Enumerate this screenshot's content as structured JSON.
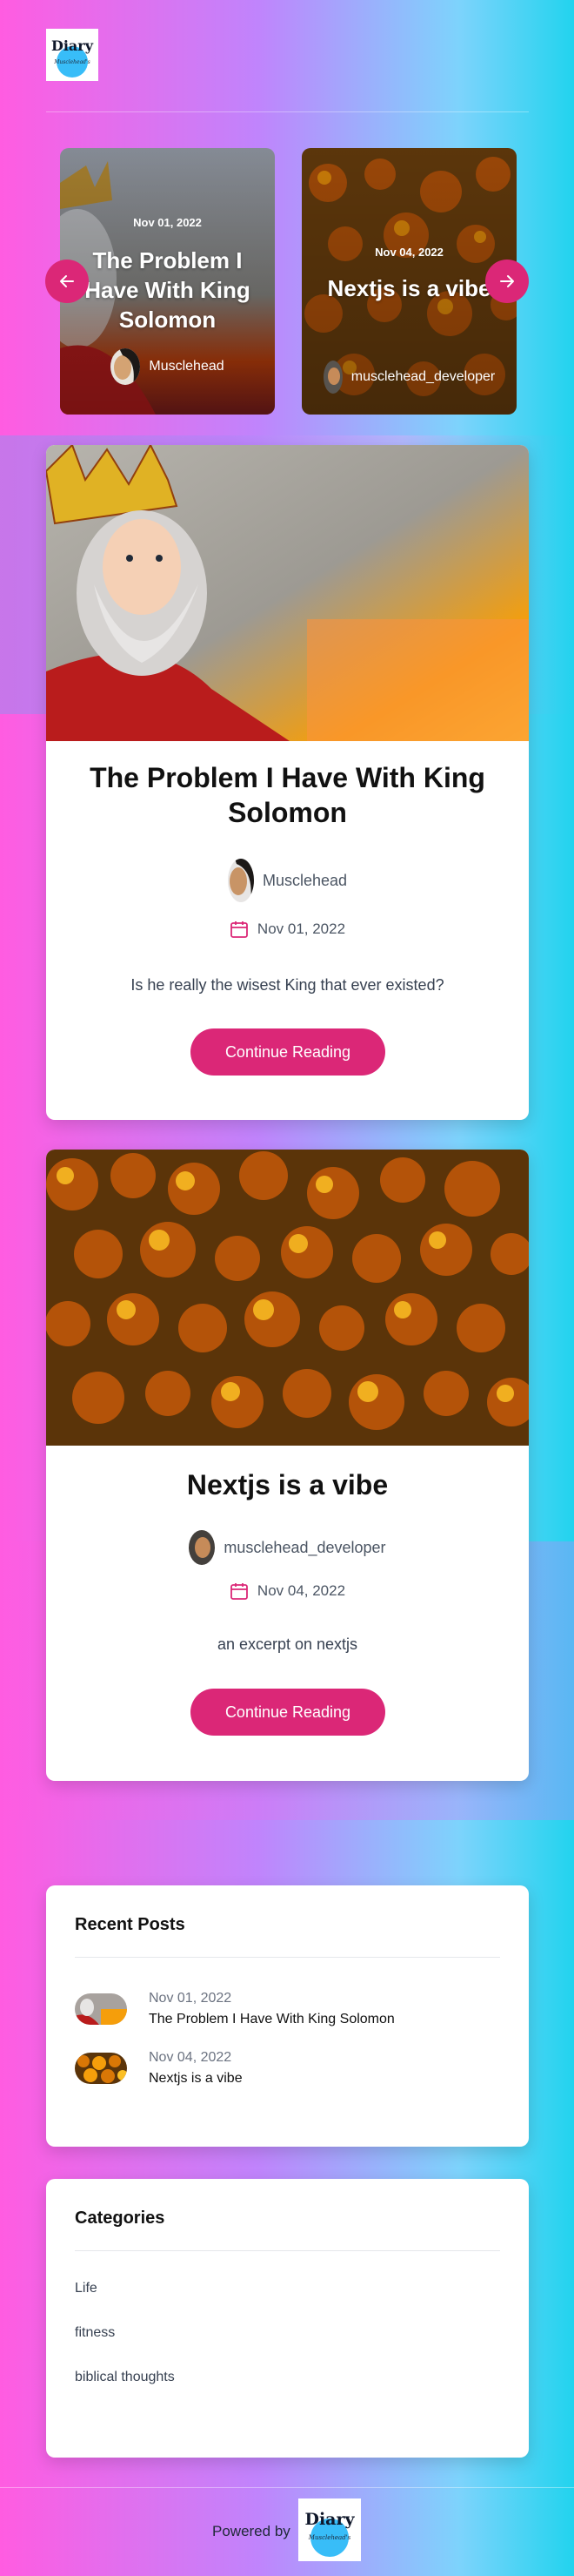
{
  "brand": {
    "logo_text": "Diary",
    "logo_subtext": "Musclehead's"
  },
  "carousel": {
    "prev_icon": "arrow-left-icon",
    "next_icon": "arrow-right-icon",
    "slides": [
      {
        "date": "Nov 01, 2022",
        "title": "The Problem I Have With King Solomon",
        "author": "Musclehead"
      },
      {
        "date": "Nov 04, 2022",
        "title": "Nextjs is a vibe",
        "author": "musclehead_developer"
      }
    ]
  },
  "posts": [
    {
      "title": "The Problem I Have With King Solomon",
      "author": "Musclehead",
      "date": "Nov 01, 2022",
      "excerpt": "Is he really the wisest King that ever existed?",
      "cta": "Continue Reading"
    },
    {
      "title": "Nextjs is a vibe",
      "author": "musclehead_developer",
      "date": "Nov 04, 2022",
      "excerpt": "an excerpt on nextjs",
      "cta": "Continue Reading"
    }
  ],
  "recent": {
    "heading": "Recent Posts",
    "items": [
      {
        "date": "Nov 01, 2022",
        "title": "The Problem I Have With King Solomon"
      },
      {
        "date": "Nov 04, 2022",
        "title": "Nextjs is a vibe"
      }
    ]
  },
  "categories": {
    "heading": "Categories",
    "items": [
      "Life",
      "fitness",
      "biblical thoughts"
    ]
  },
  "footer": {
    "powered_by": "Powered by"
  },
  "colors": {
    "accent": "#db2777",
    "gradient_start": "#ff5ce1",
    "gradient_end": "#22d3ee"
  }
}
